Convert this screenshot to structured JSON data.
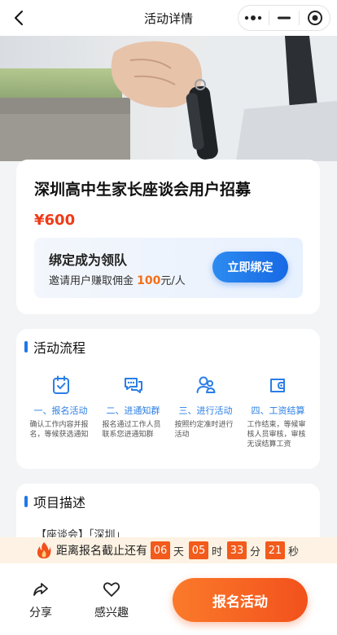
{
  "nav": {
    "title": "活动详情"
  },
  "hero": {
    "image": "hand-holding-car-key-photo"
  },
  "activity": {
    "title": "深圳高中生家长座谈会用户招募",
    "price": "¥600",
    "bind": {
      "title": "绑定成为领队",
      "sub_prefix": "邀请用户赚取佣金 ",
      "amount": "100",
      "sub_suffix": "元/人",
      "button": "立即绑定"
    }
  },
  "flow": {
    "title": "活动流程",
    "steps": [
      {
        "icon": "checklist-icon",
        "title": "一、报名活动",
        "desc": "确认工作内容并报名，等候获选通知"
      },
      {
        "icon": "chat-bubbles-icon",
        "title": "二、进通知群",
        "desc": "报名通过工作人员联系您进通知群"
      },
      {
        "icon": "people-icon",
        "title": "三、进行活动",
        "desc": "按照约定准时进行活动"
      },
      {
        "icon": "wallet-icon",
        "title": "四、工资结算",
        "desc": "工作结束，等候审核人员审核，审核无误结算工资"
      }
    ]
  },
  "description": {
    "title": "项目描述",
    "text": "【座谈会】「深圳」"
  },
  "countdown": {
    "label": "距离报名截止还有",
    "days": "06",
    "days_unit": "天",
    "hours": "05",
    "hours_unit": "时",
    "minutes": "33",
    "minutes_unit": "分",
    "seconds": "21",
    "seconds_unit": "秒"
  },
  "bottom": {
    "share": "分享",
    "interested": "感兴趣",
    "signup": "报名活动"
  },
  "colors": {
    "accent_blue": "#1e78e8",
    "price_red": "#f03a17",
    "cta_orange": "#f2511c"
  }
}
